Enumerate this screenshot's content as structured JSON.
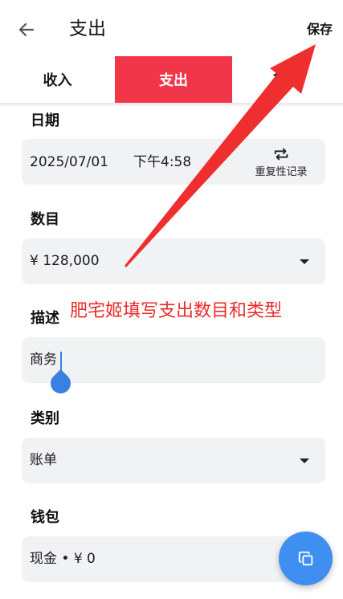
{
  "appbar": {
    "title": "支出",
    "save_label": "保存"
  },
  "tabs": [
    {
      "label": "收入",
      "selected": false
    },
    {
      "label": "支出",
      "selected": true
    },
    {
      "label": "转账",
      "selected": false
    }
  ],
  "form": {
    "date": {
      "label": "日期",
      "date_value": "2025/07/01",
      "time_value": "下午4:58",
      "repeat_label": "重复性记录"
    },
    "amount": {
      "label": "数目",
      "value": "¥ 128,000"
    },
    "description": {
      "label": "描述",
      "value": "商务"
    },
    "category": {
      "label": "类别",
      "value": "账单"
    },
    "wallet": {
      "label": "钱包",
      "value": "现金 • ¥ 0"
    }
  },
  "annotation": {
    "text": "肥宅姬填写支出数目和类型"
  },
  "colors": {
    "accent": "#f2364a",
    "annotation": "#ea2b2b",
    "fab": "#3f8ff1",
    "field_bg": "#f1f2f4",
    "cursor": "#3a80e2"
  },
  "icons": {
    "back": "arrow-left-icon",
    "repeat": "repeat-icon",
    "dropdown": "caret-down-icon",
    "fab": "copy-icon"
  }
}
